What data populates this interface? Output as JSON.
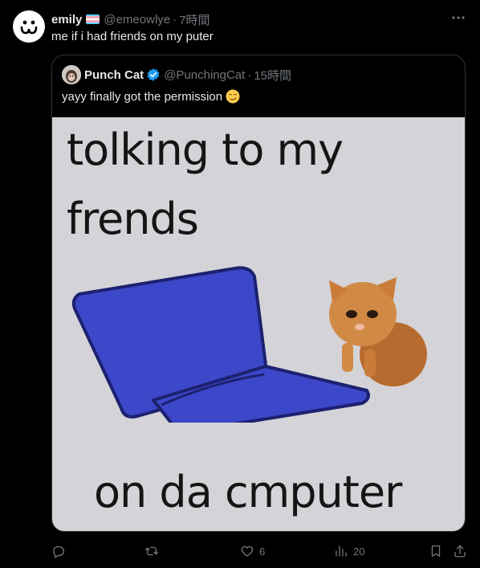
{
  "tweet": {
    "display_name": "emily",
    "handle": "@emeowlye",
    "separator": "·",
    "time": "7時間",
    "text": "me if i had friends on my puter"
  },
  "quoted": {
    "display_name": "Punch Cat",
    "handle": "@PunchingCat",
    "separator": "·",
    "time": "15時間",
    "text": "yayy finally got the permission",
    "emoji": "smirking-face",
    "image": {
      "line1": "tolking to my",
      "line2": "frends",
      "line3": "on da cmputer"
    }
  },
  "actions": {
    "reply_count": "",
    "retweet_count": "",
    "like_count": "6",
    "views_count": "20"
  },
  "colors": {
    "background": "#000000",
    "text": "#e7e9ea",
    "muted": "#71767b",
    "border": "#2f3336",
    "verified": "#1d9bf0",
    "laptop": "#3c47c9"
  }
}
